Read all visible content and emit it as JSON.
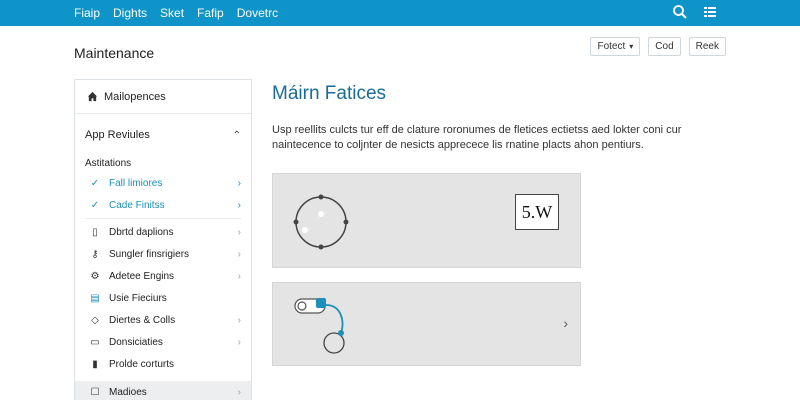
{
  "topbar": {
    "nav": [
      "Fiaip",
      "Dights",
      "Sket",
      "Fafip",
      "Dovetrc"
    ],
    "icons": [
      "search-icon",
      "menu-list-icon"
    ],
    "color": "#0f94c9"
  },
  "page": {
    "title": "Maintenance",
    "actions": {
      "select": "Fotect",
      "cod": "Cod",
      "reek": "Reek"
    }
  },
  "sidebar": {
    "header": "Mailopences",
    "section": "App Reviules",
    "subheading": "Astitations",
    "items": [
      {
        "label": "Fall limiores",
        "icon": "check-icon"
      },
      {
        "label": "Cade Finitss",
        "icon": "check-icon"
      },
      {
        "label": "Dbrtd daplions",
        "icon": "document-icon"
      },
      {
        "label": "Sungler finsrigiers",
        "icon": "key-icon"
      },
      {
        "label": "Adetee Engins",
        "icon": "gear-icon"
      },
      {
        "label": "Usie Fieciurs",
        "icon": "calendar-icon"
      },
      {
        "label": "Diertes & Colls",
        "icon": "tag-icon"
      },
      {
        "label": "Donsiciaties",
        "icon": "chat-icon"
      },
      {
        "label": "Prolde corturts",
        "icon": "folder-icon"
      },
      {
        "label": "Madioes",
        "icon": "checkbox-icon"
      }
    ]
  },
  "main": {
    "title": "Máirn Fatices",
    "description": "Usp reellits culcts tur eff de clature roronumes de fletices ectietss aed lokter coni cur naintecence to coljnter de nesicts apprecece lis rnatine placts ahon pentiurs.",
    "card1_badge": "5.W"
  },
  "colors": {
    "accent": "#1d8fb8",
    "card_bg": "#e4e4e4"
  }
}
